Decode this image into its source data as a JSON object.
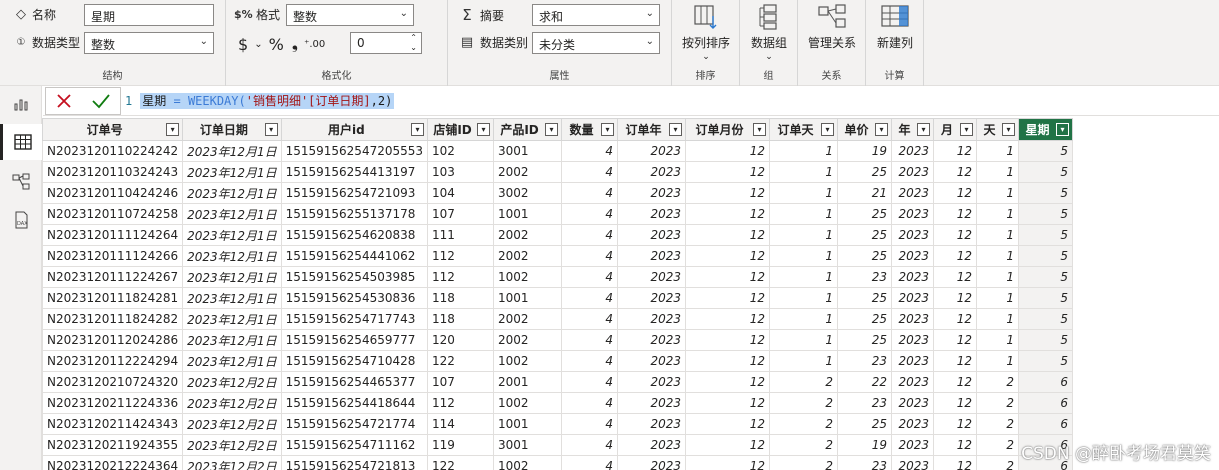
{
  "ribbon": {
    "structure": {
      "label": "结构",
      "name_label": "名称",
      "name_value": "星期",
      "datatype_label": "数据类型",
      "datatype_value": "整数"
    },
    "format": {
      "label": "格式化",
      "format_label": "格式",
      "format_value": "整数",
      "currency_symbol": "$",
      "percent_symbol": "%",
      "comma_symbol": "❟",
      "decimals_value": "0"
    },
    "properties": {
      "label": "属性",
      "summary_label": "摘要",
      "summary_value": "求和",
      "category_label": "数据类别",
      "category_value": "未分类"
    },
    "sort": {
      "label": "排序",
      "button": "按列排序"
    },
    "groups": {
      "label": "组",
      "button": "数据组"
    },
    "relations": {
      "label": "关系",
      "button": "管理关系"
    },
    "calc": {
      "label": "计算",
      "button": "新建列"
    }
  },
  "formula": {
    "line_number": "1",
    "name": "星期",
    "op": " = ",
    "fn": "WEEKDAY(",
    "arg": "'销售明细'[订单日期]",
    "tail": ",2)"
  },
  "table": {
    "columns": [
      "订单号",
      "订单日期",
      "用户id",
      "店铺ID",
      "产品ID",
      "数量",
      "订单年",
      "订单月份",
      "订单天",
      "单价",
      "年",
      "月",
      "天",
      "星期"
    ],
    "rows": [
      [
        "N2023120110224242",
        "2023年12月1日",
        "151591562547205553",
        "102",
        "3001",
        "4",
        "2023",
        "12",
        "1",
        "19",
        "2023",
        "12",
        "1",
        "5"
      ],
      [
        "N2023120110324243",
        "2023年12月1日",
        "15159156254413197",
        "103",
        "2002",
        "4",
        "2023",
        "12",
        "1",
        "25",
        "2023",
        "12",
        "1",
        "5"
      ],
      [
        "N2023120110424246",
        "2023年12月1日",
        "15159156254721093",
        "104",
        "3002",
        "4",
        "2023",
        "12",
        "1",
        "21",
        "2023",
        "12",
        "1",
        "5"
      ],
      [
        "N2023120110724258",
        "2023年12月1日",
        "15159156255137178",
        "107",
        "1001",
        "4",
        "2023",
        "12",
        "1",
        "25",
        "2023",
        "12",
        "1",
        "5"
      ],
      [
        "N2023120111124264",
        "2023年12月1日",
        "15159156254620838",
        "111",
        "2002",
        "4",
        "2023",
        "12",
        "1",
        "25",
        "2023",
        "12",
        "1",
        "5"
      ],
      [
        "N2023120111124266",
        "2023年12月1日",
        "15159156254441062",
        "112",
        "2002",
        "4",
        "2023",
        "12",
        "1",
        "25",
        "2023",
        "12",
        "1",
        "5"
      ],
      [
        "N2023120111224267",
        "2023年12月1日",
        "15159156254503985",
        "112",
        "1002",
        "4",
        "2023",
        "12",
        "1",
        "23",
        "2023",
        "12",
        "1",
        "5"
      ],
      [
        "N2023120111824281",
        "2023年12月1日",
        "15159156254530836",
        "118",
        "1001",
        "4",
        "2023",
        "12",
        "1",
        "25",
        "2023",
        "12",
        "1",
        "5"
      ],
      [
        "N2023120111824282",
        "2023年12月1日",
        "15159156254717743",
        "118",
        "2002",
        "4",
        "2023",
        "12",
        "1",
        "25",
        "2023",
        "12",
        "1",
        "5"
      ],
      [
        "N2023120112024286",
        "2023年12月1日",
        "15159156254659777",
        "120",
        "2002",
        "4",
        "2023",
        "12",
        "1",
        "25",
        "2023",
        "12",
        "1",
        "5"
      ],
      [
        "N2023120112224294",
        "2023年12月1日",
        "15159156254710428",
        "122",
        "1002",
        "4",
        "2023",
        "12",
        "1",
        "23",
        "2023",
        "12",
        "1",
        "5"
      ],
      [
        "N2023120210724320",
        "2023年12月2日",
        "15159156254465377",
        "107",
        "2001",
        "4",
        "2023",
        "12",
        "2",
        "22",
        "2023",
        "12",
        "2",
        "6"
      ],
      [
        "N2023120211224336",
        "2023年12月2日",
        "15159156254418644",
        "112",
        "1002",
        "4",
        "2023",
        "12",
        "2",
        "23",
        "2023",
        "12",
        "2",
        "6"
      ],
      [
        "N2023120211424343",
        "2023年12月2日",
        "15159156254721774",
        "114",
        "1001",
        "4",
        "2023",
        "12",
        "2",
        "25",
        "2023",
        "12",
        "2",
        "6"
      ],
      [
        "N2023120211924355",
        "2023年12月2日",
        "15159156254711162",
        "119",
        "3001",
        "4",
        "2023",
        "12",
        "2",
        "19",
        "2023",
        "12",
        "2",
        "6"
      ],
      [
        "N2023120212224364",
        "2023年12月2日",
        "15159156254721813",
        "122",
        "1002",
        "4",
        "2023",
        "12",
        "2",
        "23",
        "2023",
        "12",
        "2",
        "6"
      ]
    ]
  },
  "watermark": "CSDN @醉卧考场君莫笑"
}
